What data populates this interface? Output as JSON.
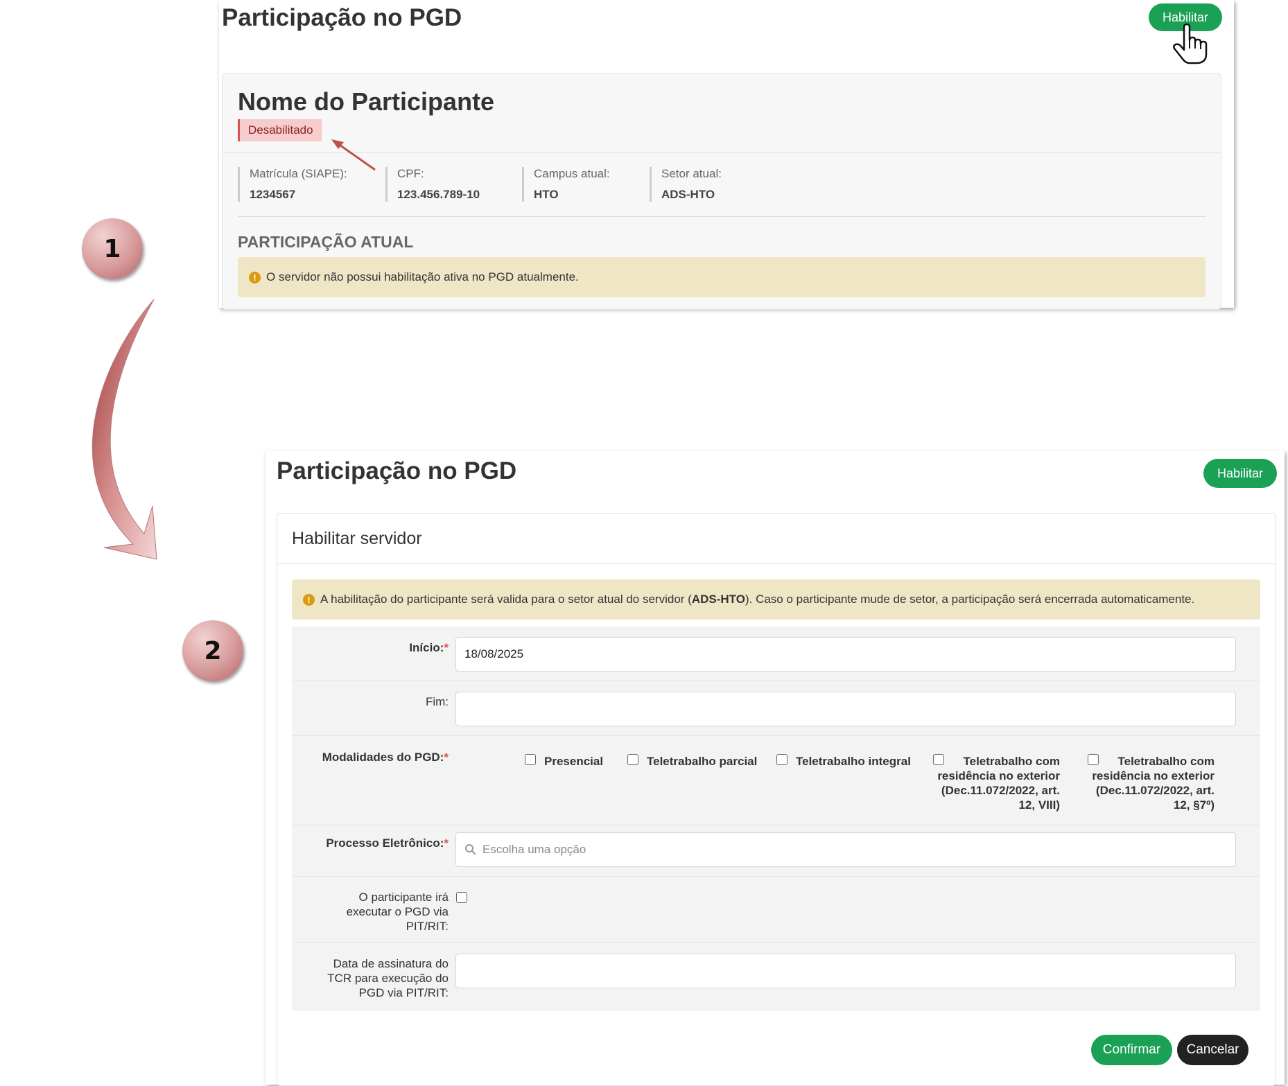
{
  "step1": {
    "number": "1",
    "page_title": "Participação no PGD",
    "habilitar_label": "Habilitar",
    "participant_name": "Nome do Participante",
    "status_badge": "Desabilitado",
    "info": [
      {
        "label": "Matrícula (SIAPE):",
        "value": "1234567"
      },
      {
        "label": "CPF:",
        "value": "123.456.789-10"
      },
      {
        "label": "Campus atual:",
        "value": "HTO"
      },
      {
        "label": "Setor atual:",
        "value": "ADS-HTO"
      }
    ],
    "section_title": "PARTICIPAÇÃO ATUAL",
    "alert": "O servidor não possui habilitação ativa no PGD atualmente."
  },
  "step2": {
    "number": "2",
    "page_title": "Participação no PGD",
    "habilitar_label": "Habilitar",
    "card_title": "Habilitar servidor",
    "alert_before": "A habilitação do participante será valida para o setor atual do servidor (",
    "alert_bold": "ADS-HTO",
    "alert_after": "). Caso o participante mude de setor, a participação será encerrada automaticamente.",
    "form": {
      "inicio_label": "Início:",
      "inicio_value": "18/08/2025",
      "fim_label": "Fim:",
      "fim_value": "",
      "modalidades_label": "Modalidades do PGD:",
      "modalidades": [
        {
          "label": "Presencial",
          "checked": false
        },
        {
          "label": "Teletrabalho parcial",
          "checked": false
        },
        {
          "label": "Teletrabalho integral",
          "checked": false
        },
        {
          "label": "Teletrabalho com residência no exterior (Dec.11.072/2022, art. 12, VIII)",
          "checked": false
        },
        {
          "label": "Teletrabalho com residência no exterior (Dec.11.072/2022, art. 12, §7º)",
          "checked": false
        }
      ],
      "processo_label": "Processo Eletrônico:",
      "processo_placeholder": "Escolha uma opção",
      "pit_label": "O participante irá executar o PGD via PIT/RIT:",
      "pit_checked": false,
      "tcr_label": "Data de assinatura do TCR para execução do PGD via PIT/RIT:",
      "tcr_value": ""
    },
    "confirm_label": "Confirmar",
    "cancel_label": "Cancelar"
  },
  "icons": [
    "hand-cursor-icon",
    "warning-icon",
    "search-icon",
    "red-arrow-icon",
    "flow-arrow-icon"
  ],
  "colors": {
    "green": "#1aa156",
    "warning_bg": "#efe6c6",
    "badge_bg": "#f6cccc",
    "step_circle": "#d79a9a"
  }
}
